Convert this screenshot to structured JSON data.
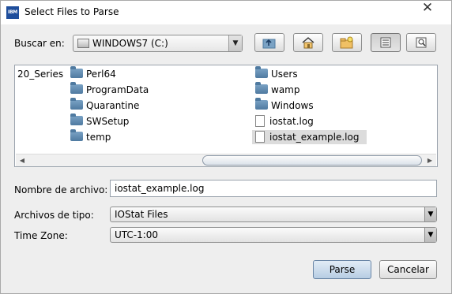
{
  "window": {
    "title": "Select Files to Parse",
    "app_icon_text": "IBM",
    "close_glyph": "✕"
  },
  "lookin": {
    "label": "Buscar en:",
    "value": "WINDOWS7 (C:)"
  },
  "toolbar": {
    "icons": [
      "up-folder-icon",
      "home-icon",
      "new-folder-icon",
      "list-view-icon",
      "details-view-icon"
    ]
  },
  "files": {
    "col1": [
      "20_Series"
    ],
    "col2": [
      "Perl64",
      "ProgramData",
      "Quarantine",
      "SWSetup",
      "temp"
    ],
    "col3_folders": [
      "Users",
      "wamp",
      "Windows"
    ],
    "col3_files": [
      "iostat.log",
      "iostat_example.log"
    ],
    "selected": "iostat_example.log"
  },
  "filename": {
    "label": "Nombre de archivo:",
    "value": "iostat_example.log"
  },
  "filetype": {
    "label": "Archivos de tipo:",
    "value": "IOStat Files"
  },
  "timezone": {
    "label": "Time Zone:",
    "value": "UTC-1:00"
  },
  "buttons": {
    "parse": "Parse",
    "cancel": "Cancelar"
  }
}
